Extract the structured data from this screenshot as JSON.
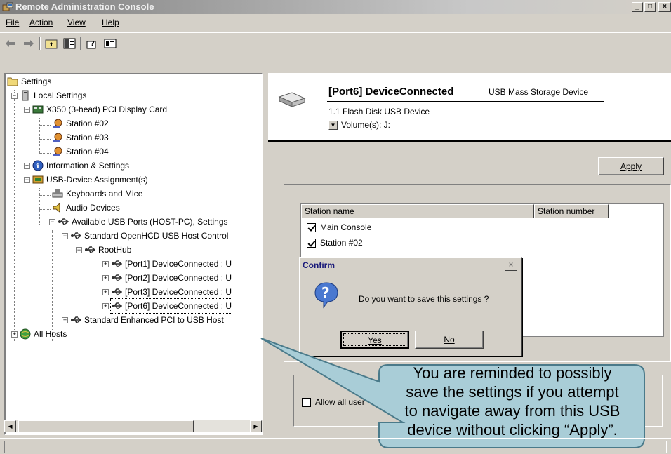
{
  "window": {
    "title": "Remote Administration Console",
    "minimize": "_",
    "maximize": "□",
    "close": "×"
  },
  "menu": [
    "File",
    "Action",
    "View",
    "Help"
  ],
  "toolbar": {
    "buttons": [
      "back-arrow-icon",
      "forward-arrow-icon",
      "up-folder-icon",
      "show-hide-tree-icon",
      "help-icon",
      "properties-icon"
    ]
  },
  "tree": {
    "items": [
      {
        "label": "Settings",
        "icon": "folder-icon"
      },
      {
        "label": "Local Settings",
        "icon": "computer-tower-icon"
      },
      {
        "label": "X350 (3-head)  PCI Display Card",
        "icon": "display-card-icon"
      },
      {
        "label": "Station #02",
        "icon": "station-icon"
      },
      {
        "label": "Station #03",
        "icon": "station-icon"
      },
      {
        "label": "Station #04",
        "icon": "station-icon"
      },
      {
        "label": "Information & Settings",
        "icon": "info-icon"
      },
      {
        "label": "USB-Device Assignment(s)",
        "icon": "usb-assign-icon"
      },
      {
        "label": "Keyboards and Mice",
        "icon": "keyboard-icon"
      },
      {
        "label": "Audio Devices",
        "icon": "speaker-icon"
      },
      {
        "label": "Available USB Ports (HOST-PC), Settings",
        "icon": "usb-icon"
      },
      {
        "label": "Standard OpenHCD USB Host Control",
        "icon": "usb-icon"
      },
      {
        "label": "RootHub",
        "icon": "usb-icon"
      },
      {
        "label": "[Port1] DeviceConnected :  U",
        "icon": "usb-icon"
      },
      {
        "label": "[Port2] DeviceConnected :  U",
        "icon": "usb-icon"
      },
      {
        "label": "[Port3] DeviceConnected :  U",
        "icon": "usb-icon"
      },
      {
        "label": "[Port6] DeviceConnected :  U",
        "icon": "usb-icon"
      },
      {
        "label": "Standard Enhanced PCI to USB Host",
        "icon": "usb-icon"
      },
      {
        "label": "All Hosts",
        "icon": "globe-icon"
      }
    ]
  },
  "device": {
    "port_title": "[Port6] DeviceConnected",
    "device_type": "USB Mass Storage Device",
    "device_name": "1.1 Flash Disk USB Device",
    "volumes": "Volume(s):  J:"
  },
  "apply_button": "Apply",
  "stations": {
    "columns": [
      "Station name",
      "Station number"
    ],
    "rows": [
      {
        "name": "Main Console",
        "checked": true
      },
      {
        "name": "Station #02",
        "checked": true
      }
    ]
  },
  "allow_all_label": "Allow all user",
  "dialog": {
    "title": "Confirm",
    "message": "Do you want to save this settings ?",
    "yes": "Yes",
    "no": "No",
    "close": "×"
  },
  "callout": {
    "lines": [
      "You are reminded to possibly",
      "save the settings if you attempt",
      "to navigate away from this USB",
      "device without clicking “Apply”."
    ],
    "fill": "#a9cdd7"
  }
}
